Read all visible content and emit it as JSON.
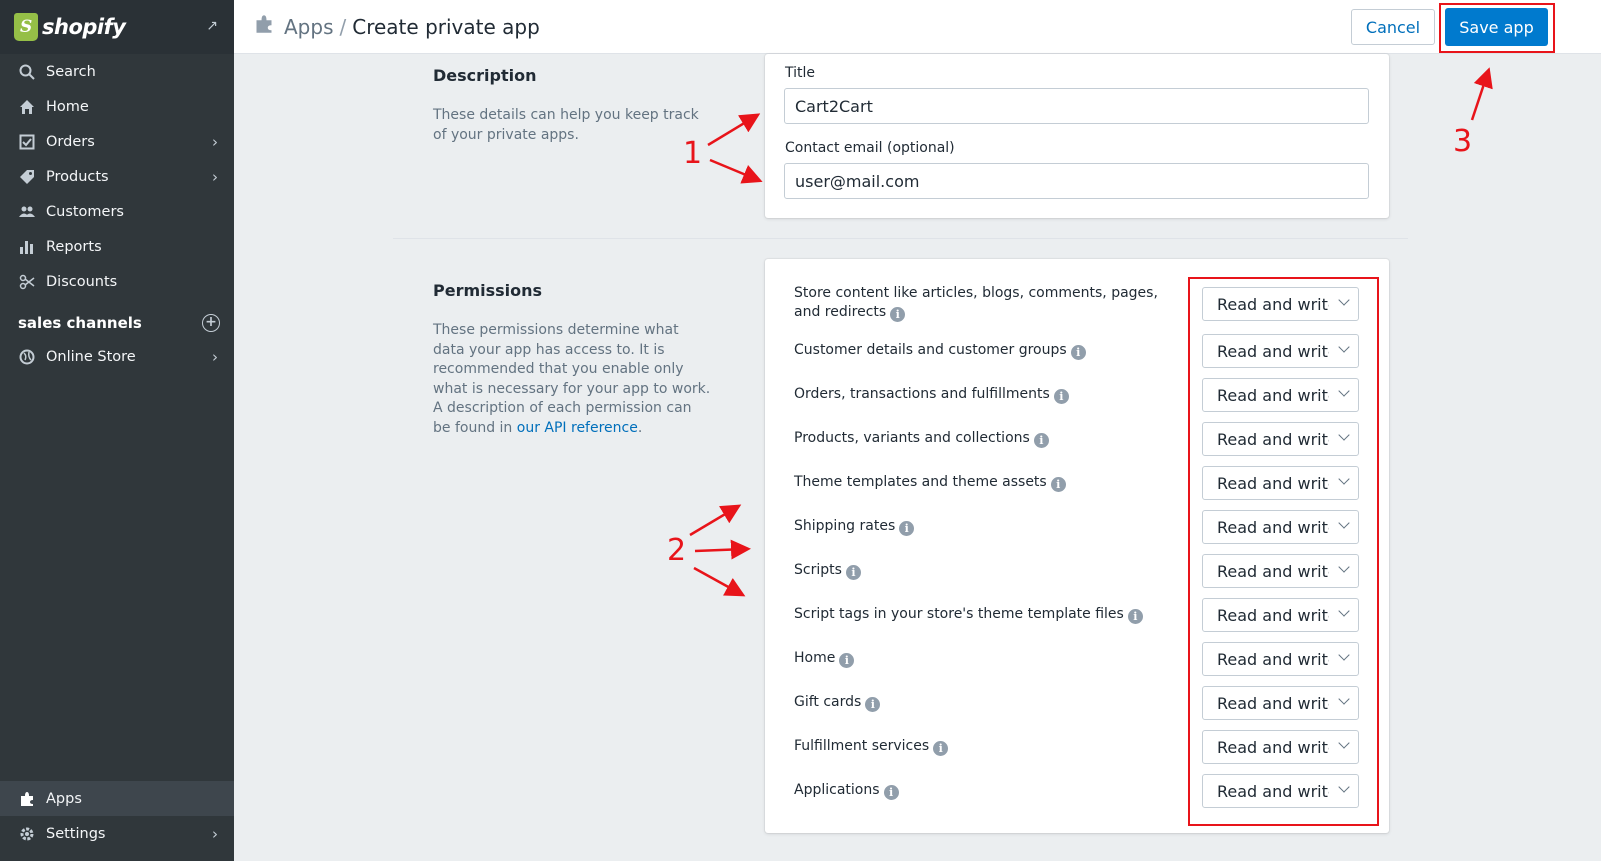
{
  "sidebar": {
    "brand": "shopify",
    "search": "Search",
    "items": [
      {
        "label": "Home",
        "icon": "home-icon"
      },
      {
        "label": "Orders",
        "icon": "orders-icon",
        "chevron": true
      },
      {
        "label": "Products",
        "icon": "tag-icon",
        "chevron": true
      },
      {
        "label": "Customers",
        "icon": "customers-icon"
      },
      {
        "label": "Reports",
        "icon": "reports-icon"
      },
      {
        "label": "Discounts",
        "icon": "discounts-icon"
      }
    ],
    "channels_title": "sales channels",
    "online_store": "Online Store",
    "apps": "Apps",
    "settings": "Settings"
  },
  "header": {
    "breadcrumb_parent": "Apps",
    "separator": "/",
    "title": "Create private app",
    "cancel_label": "Cancel",
    "save_label": "Save app"
  },
  "description": {
    "heading": "Description",
    "help": "These details can help you keep track of your private apps.",
    "title_label": "Title",
    "title_value": "Cart2Cart",
    "email_label": "Contact email (optional)",
    "email_value": "user@mail.com"
  },
  "permissions": {
    "heading": "Permissions",
    "help_prefix": "These permissions determine what data your app has access to. It is recommended that you enable only what is necessary for your app to work. A description of each permission can be found in ",
    "help_link": "our API reference",
    "help_suffix": ".",
    "rows": [
      {
        "label": "Store content like articles, blogs, comments, pages, and redirects",
        "value": "Read and write"
      },
      {
        "label": "Customer details and customer groups",
        "value": "Read and write"
      },
      {
        "label": "Orders, transactions and fulfillments",
        "value": "Read and write"
      },
      {
        "label": "Products, variants and collections",
        "value": "Read and write"
      },
      {
        "label": "Theme templates and theme assets",
        "value": "Read and write"
      },
      {
        "label": "Shipping rates",
        "value": "Read and write"
      },
      {
        "label": "Scripts",
        "value": "Read and write"
      },
      {
        "label": "Script tags in your store's theme template files",
        "value": "Read and write"
      },
      {
        "label": "Home",
        "value": "Read and write"
      },
      {
        "label": "Gift cards",
        "value": "Read and write"
      },
      {
        "label": "Fulfillment services",
        "value": "Read and write"
      },
      {
        "label": "Applications",
        "value": "Read and write"
      }
    ]
  },
  "annotations": {
    "one": "1",
    "two": "2",
    "three": "3"
  },
  "colors": {
    "primary": "#007ace",
    "sidebar": "#30373b",
    "annotation": "#e8141a"
  }
}
